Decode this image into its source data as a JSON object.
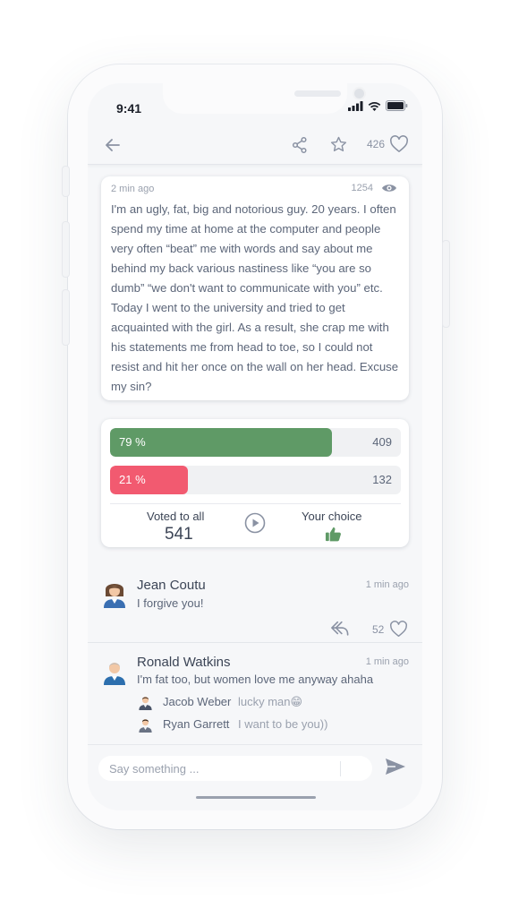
{
  "status": {
    "time": "9:41"
  },
  "toolbar": {
    "likes": "426",
    "back_icon": "back-arrow-icon",
    "share_icon": "share-icon",
    "star_icon": "star-icon",
    "heart_icon": "heart-icon"
  },
  "post": {
    "time": "2 min ago",
    "views": "1254",
    "text": "I'm an ugly, fat, big and notorious guy. 20 years. I often spend my time at home at the computer and people very often “beat” me with words and say about me behind my back various nastiness like “you are so dumb” “we don't want to communicate with you” etc. Today I went to the university and tried to get acquainted with the girl. As a result, she crap me with his statements me from head to toe, so I could not resist and hit her once on the wall on her head. Excuse my sin?"
  },
  "poll": {
    "options": [
      {
        "percent_label": "79 %",
        "fraction": 0.764,
        "count": "409",
        "color": "#5f9a66"
      },
      {
        "percent_label": "21 %",
        "fraction": 0.268,
        "count": "132",
        "color": "#f25a70"
      }
    ],
    "voted_label": "Voted to all",
    "voted_total": "541",
    "choice_label": "Your choice",
    "accent_green": "#5f9a66"
  },
  "comments": [
    {
      "name": "Jean Coutu",
      "time": "1 min ago",
      "text": "I forgive you!",
      "likes": "52"
    },
    {
      "name": "Ronald Watkins",
      "time": "1 min ago",
      "text": "I'm fat too, but women love me anyway ahaha",
      "replies": [
        {
          "name": "Jacob Weber",
          "text": "lucky man😁"
        },
        {
          "name": "Ryan Garrett",
          "text": "I want to be you))"
        }
      ]
    }
  ],
  "composer": {
    "placeholder": "Say something ..."
  }
}
